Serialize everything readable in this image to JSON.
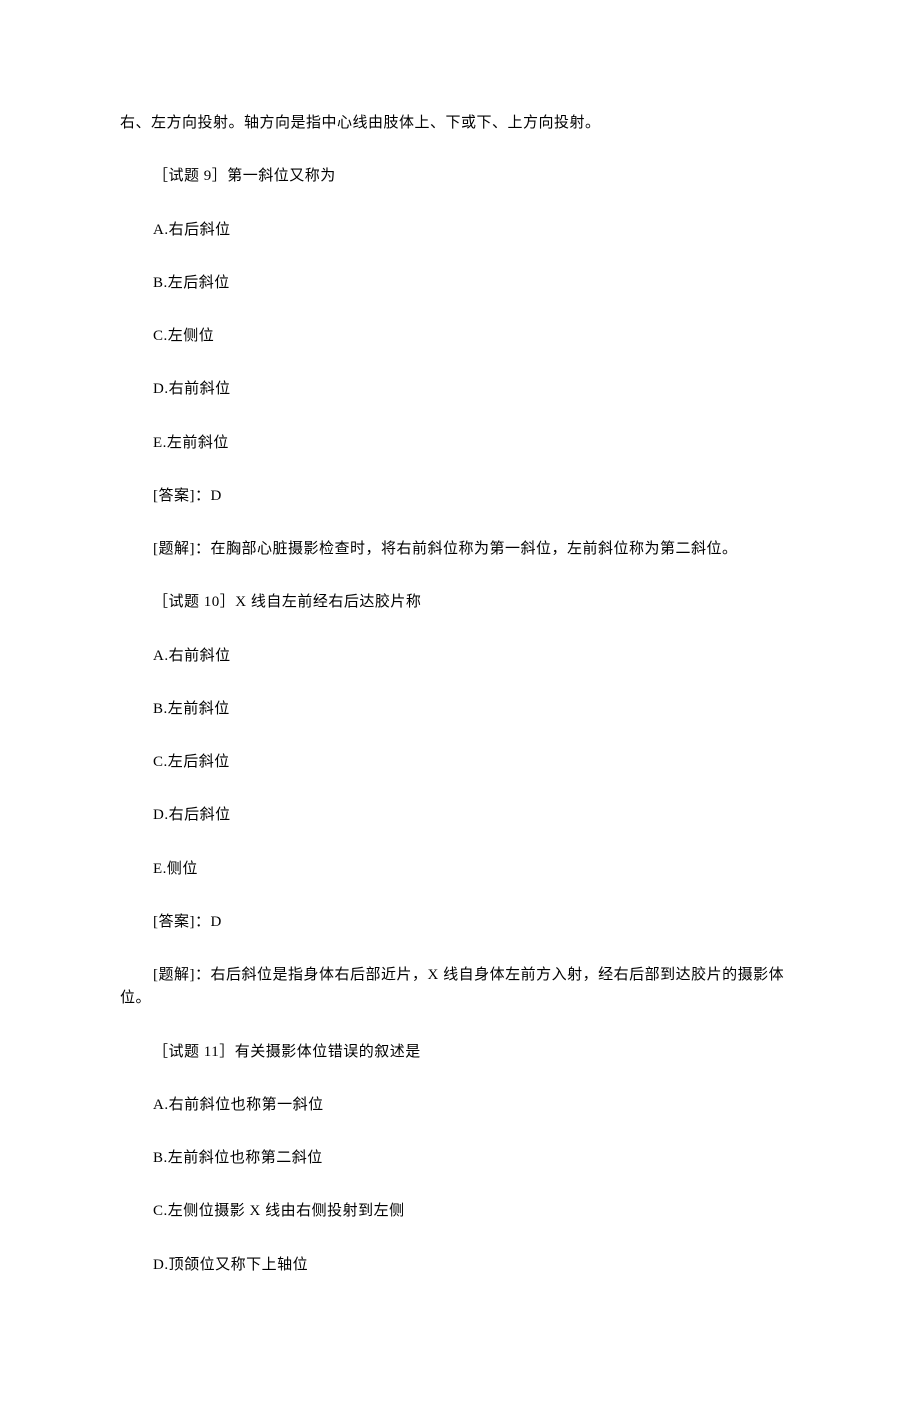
{
  "intro_continuation": "右、左方向投射。轴方向是指中心线由肢体上、下或下、上方向投射。",
  "q9": {
    "title": "［试题 9］第一斜位又称为",
    "optA": "A.右后斜位",
    "optB": "B.左后斜位",
    "optC": "C.左侧位",
    "optD": "D.右前斜位",
    "optE": "E.左前斜位",
    "answer": "[答案]：D",
    "explanation": "[题解]：在胸部心脏摄影检查时，将右前斜位称为第一斜位，左前斜位称为第二斜位。"
  },
  "q10": {
    "title": "［试题 10］X 线自左前经右后达胶片称",
    "optA": "A.右前斜位",
    "optB": "B.左前斜位",
    "optC": "C.左后斜位",
    "optD": "D.右后斜位",
    "optE": "E.侧位",
    "answer": "[答案]：D",
    "explanation": "[题解]：右后斜位是指身体右后部近片，X 线自身体左前方入射，经右后部到达胶片的摄影体位。"
  },
  "q11": {
    "title": "［试题 11］有关摄影体位错误的叙述是",
    "optA": "A.右前斜位也称第一斜位",
    "optB": "B.左前斜位也称第二斜位",
    "optC": "C.左侧位摄影 X 线由右侧投射到左侧",
    "optD": "D.顶颌位又称下上轴位"
  }
}
